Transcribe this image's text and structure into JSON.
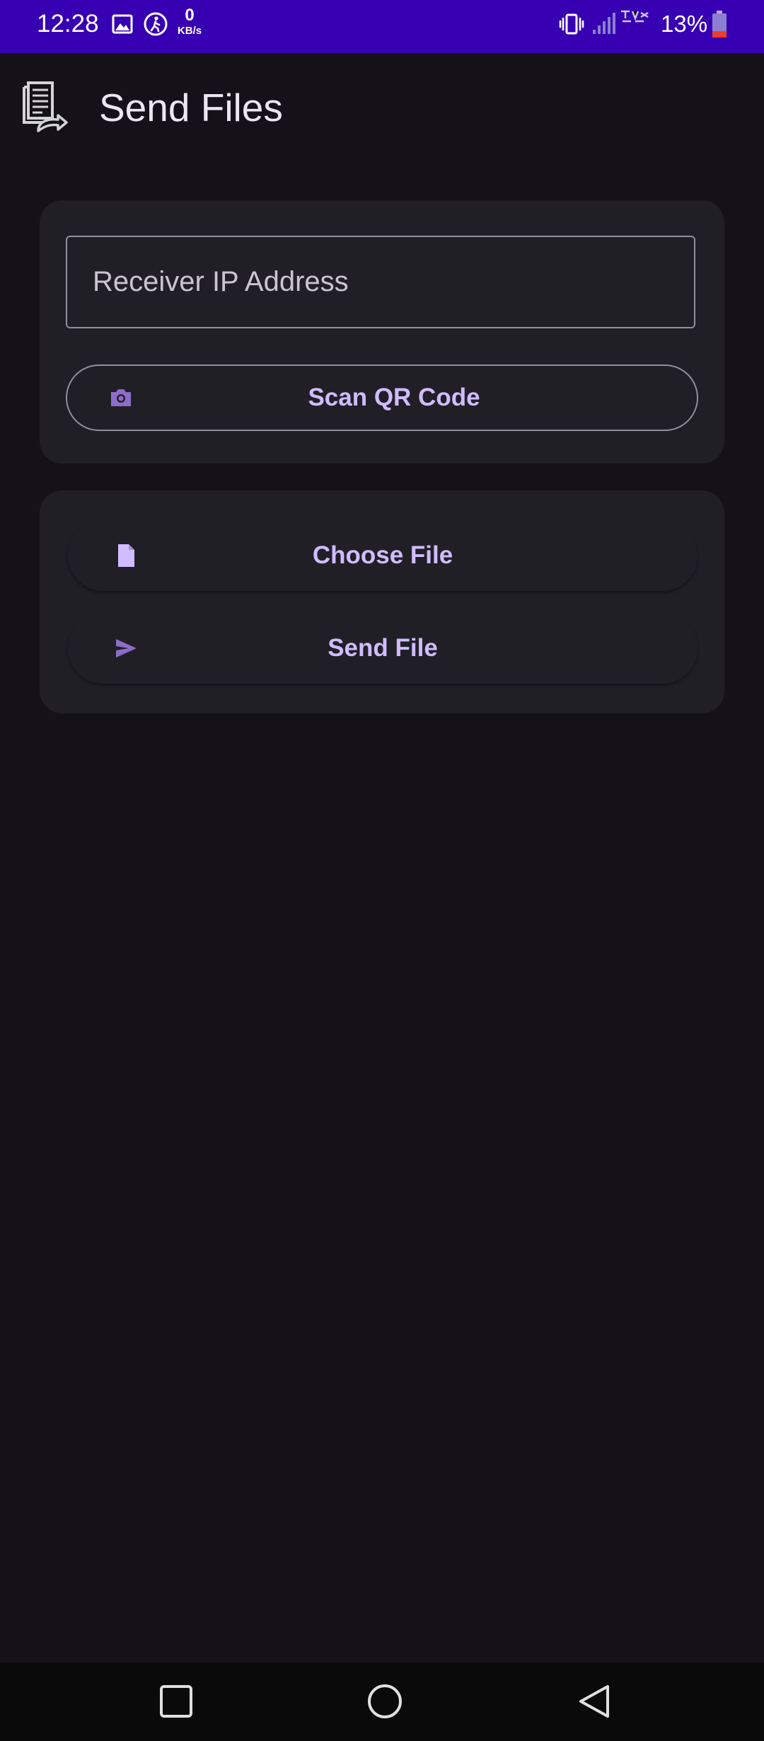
{
  "status_bar": {
    "time": "12:28",
    "net_speed_value": "0",
    "net_speed_unit": "KB/s",
    "battery_percent": "13%",
    "icons": [
      "image-icon",
      "accessibility-icon",
      "vibrate-icon",
      "signal-icon",
      "battery-icon"
    ]
  },
  "app_bar": {
    "title": "Send Files",
    "logo_icon": "document-share-icon"
  },
  "connection_card": {
    "ip_placeholder": "Receiver IP Address",
    "ip_value": "",
    "scan_label": "Scan QR Code",
    "scan_icon": "camera-icon"
  },
  "file_card": {
    "choose_label": "Choose File",
    "choose_icon": "file-icon",
    "send_label": "Send File",
    "send_icon": "send-icon"
  },
  "nav_bar": {
    "icons": [
      "recents-icon",
      "home-icon",
      "back-icon"
    ]
  },
  "colors": {
    "status_bar": "#3700b3",
    "background": "#141218",
    "surface": "#211f26",
    "accent": "#d0bcff",
    "outline": "#938f99"
  }
}
